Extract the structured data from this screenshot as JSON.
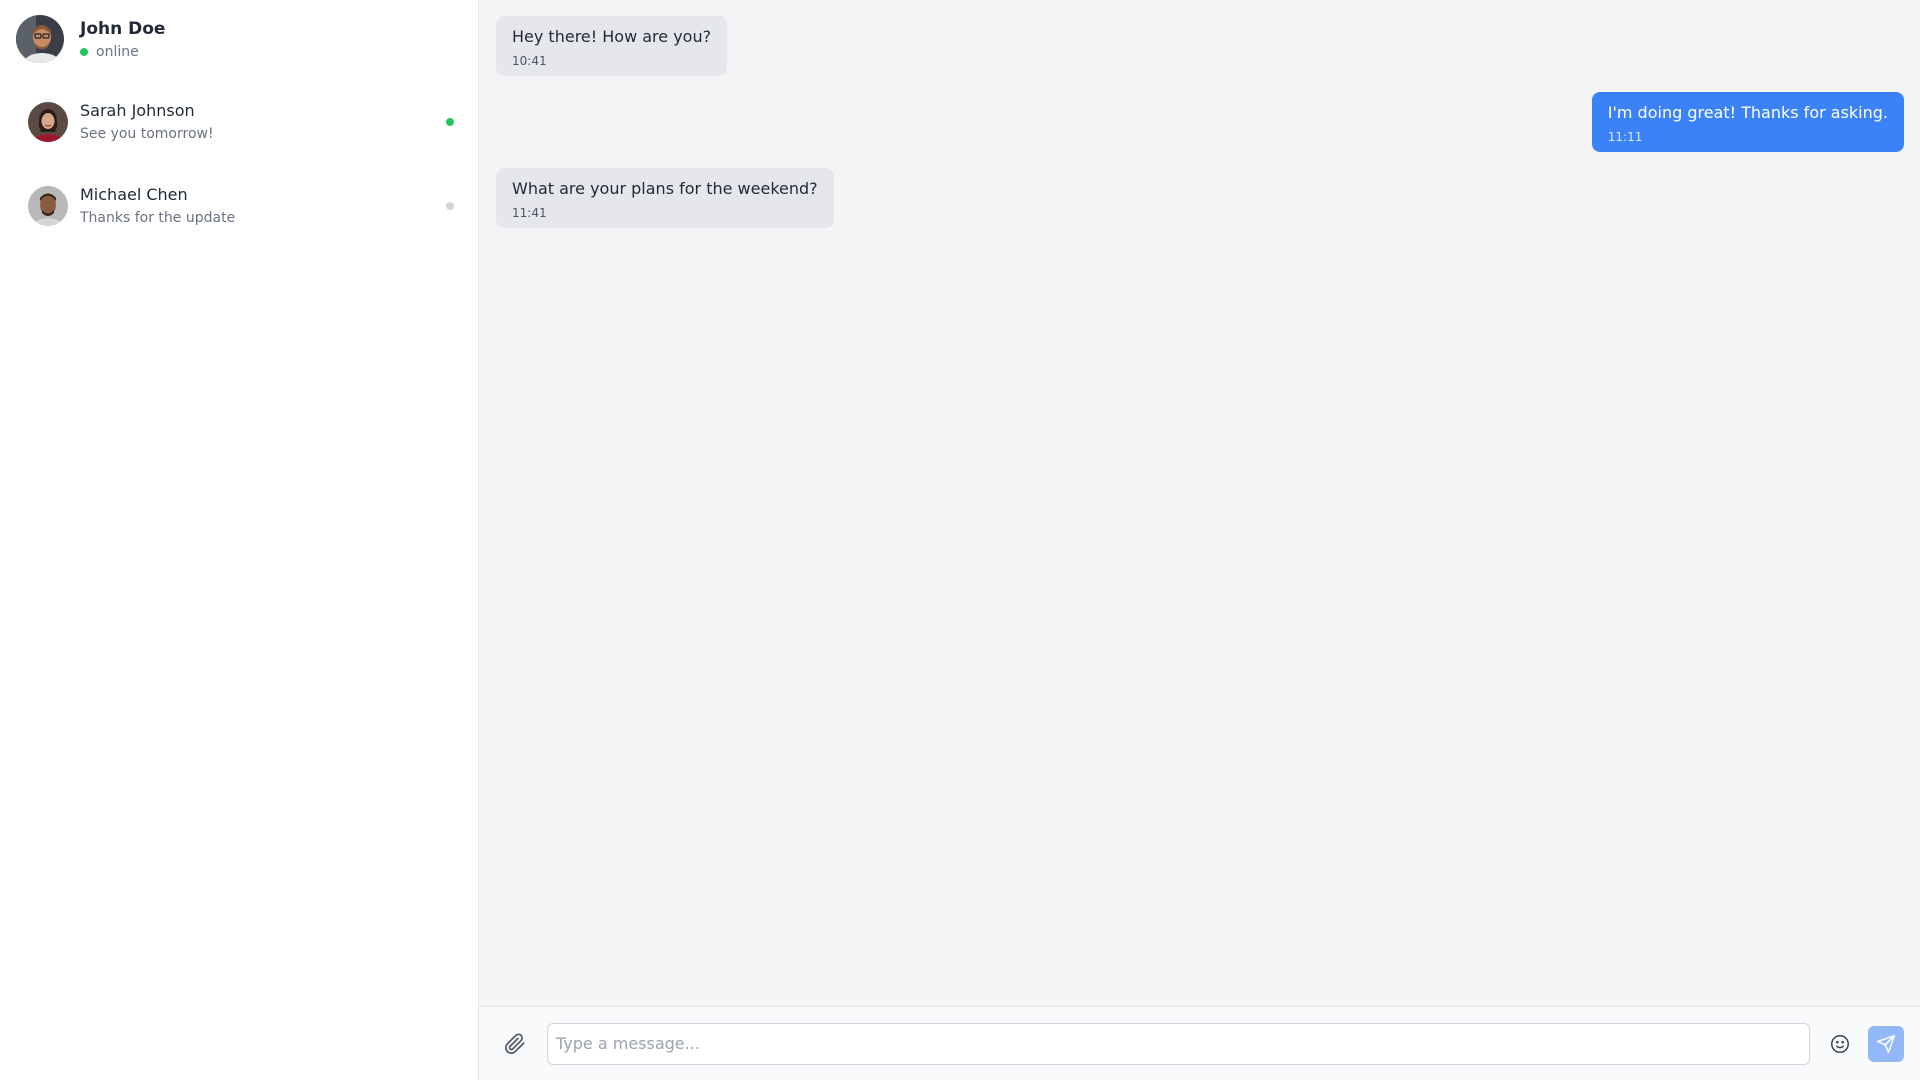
{
  "colors": {
    "online": "#22c55e",
    "offline": "#d1d5db",
    "outgoing_bubble": "#3b82f6",
    "incoming_bubble": "#e5e7eb",
    "send_button": "#93b8f7"
  },
  "profile": {
    "name": "John Doe",
    "status": "online"
  },
  "contacts": [
    {
      "name": "Sarah Johnson",
      "preview": "See you tomorrow!",
      "presence": "online"
    },
    {
      "name": "Michael Chen",
      "preview": "Thanks for the update",
      "presence": "offline"
    }
  ],
  "messages": [
    {
      "direction": "incoming",
      "text": "Hey there! How are you?",
      "time": "10:41"
    },
    {
      "direction": "outgoing",
      "text": "I'm doing great! Thanks for asking.",
      "time": "11:11"
    },
    {
      "direction": "incoming",
      "text": "What are your plans for the weekend?",
      "time": "11:41"
    }
  ],
  "composer": {
    "placeholder": "Type a message...",
    "value": "",
    "attach_icon": "paperclip-icon",
    "emoji_icon": "smiley-icon",
    "send_icon": "send-icon"
  }
}
